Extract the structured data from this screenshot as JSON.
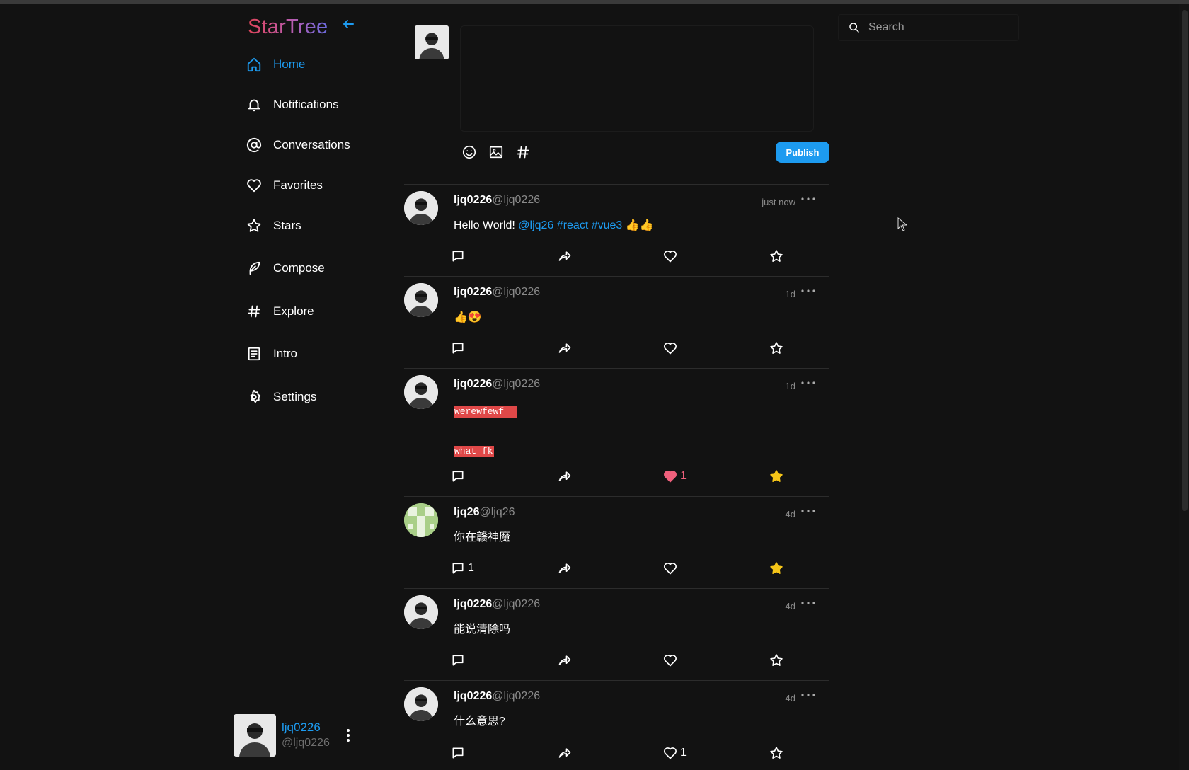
{
  "brand": {
    "title": "StarTree"
  },
  "nav": {
    "items": [
      {
        "label": "Home",
        "icon": "home-icon",
        "active": true
      },
      {
        "label": "Notifications",
        "icon": "bell-icon"
      },
      {
        "label": "Conversations",
        "icon": "at-icon"
      },
      {
        "label": "Favorites",
        "icon": "heart-icon"
      },
      {
        "label": "Stars",
        "icon": "star-icon"
      },
      {
        "label": "Compose",
        "icon": "feather-icon"
      },
      {
        "label": "Explore",
        "icon": "hashtag-icon"
      },
      {
        "label": "Intro",
        "icon": "document-icon"
      },
      {
        "label": "Settings",
        "icon": "gear-icon"
      }
    ]
  },
  "current_user": {
    "name": "ljq0226",
    "handle": "@ljq0226"
  },
  "composer": {
    "value": "",
    "publish_label": "Publish"
  },
  "search": {
    "placeholder": "Search"
  },
  "posts": [
    {
      "name": "ljq0226",
      "handle": "@ljq0226",
      "time": "just now",
      "text": "Hello World! ",
      "mention": "@ljq26",
      "tags": [
        "#react",
        "#vue3"
      ],
      "emoji": "👍👍",
      "reply_count": "",
      "like_count": "",
      "liked": false,
      "starred": false
    },
    {
      "name": "ljq0226",
      "handle": "@ljq0226",
      "time": "1d",
      "text": "👍😍",
      "reply_count": "",
      "like_count": "",
      "liked": false,
      "starred": false
    },
    {
      "name": "ljq0226",
      "handle": "@ljq0226",
      "time": "1d",
      "code_lines": [
        "werewfewf",
        "what fk"
      ],
      "reply_count": "",
      "like_count": "1",
      "liked": true,
      "starred": true
    },
    {
      "name": "ljq26",
      "handle": "@ljq26",
      "time": "4d",
      "text": "你在赣神魔",
      "reply_count": "1",
      "like_count": "",
      "liked": false,
      "starred": true
    },
    {
      "name": "ljq0226",
      "handle": "@ljq0226",
      "time": "4d",
      "text": "能说清除吗",
      "reply_count": "",
      "like_count": "",
      "liked": false,
      "starred": false
    },
    {
      "name": "ljq0226",
      "handle": "@ljq0226",
      "time": "4d",
      "text": "什么意思?",
      "reply_count": "",
      "like_count": "1",
      "liked": false,
      "starred": false
    }
  ],
  "colors": {
    "accent": "#1d9bf0",
    "like_red": "#f0607c",
    "star_gold": "#f5c518",
    "code_bg": "#e04848"
  }
}
